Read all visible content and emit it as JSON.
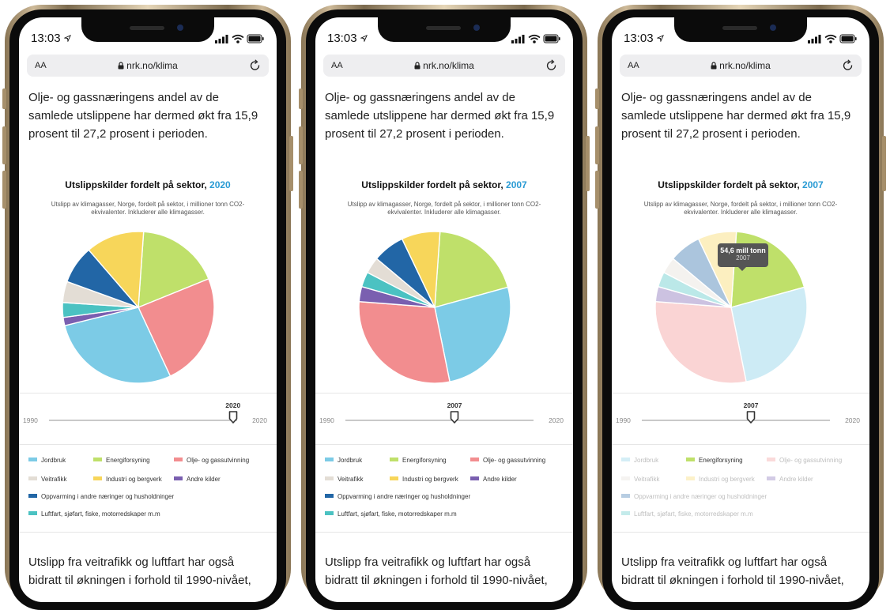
{
  "status": {
    "time": "13:03"
  },
  "browser": {
    "aa_label": "AA",
    "url": "nrk.no/klima"
  },
  "article": {
    "para1": "Olje- og gassnæringens andel av de samlede utslippene har dermed økt fra 15,9 prosent til 27,2 prosent i perioden.",
    "para2": "Utslipp fra veitrafikk og luftfart har også bidratt til økningen i forhold til 1990-nivået,"
  },
  "chart": {
    "title": "Utslippskilder fordelt på sektor,",
    "subtitle": "Utslipp av klimagasser, Norge, fordelt på sektor, i millioner tonn CO2-ekvivalenter. Inkluderer alle klimagasser.",
    "slider_min": "1990",
    "slider_max": "2020"
  },
  "legend": [
    {
      "label": "Jordbruk",
      "color": "#7ccbe6"
    },
    {
      "label": "Energiforsyning",
      "color": "#bfe06a"
    },
    {
      "label": "Olje- og gassutvinning",
      "color": "#f28d8f"
    },
    {
      "label": "Veitrafikk",
      "color": "#e3ddd5"
    },
    {
      "label": "Industri og bergverk",
      "color": "#f7d65a"
    },
    {
      "label": "Andre kilder",
      "color": "#7a5fb0"
    },
    {
      "label": "Oppvarming i andre næringer og husholdninger",
      "color": "#2266a6"
    },
    {
      "label": "Luftfart, sjøfart, fiske, motorredskaper m.m",
      "color": "#4bc2c2"
    }
  ],
  "tooltip": {
    "value": "54,6 mill tonn",
    "year": "2007"
  },
  "phones": [
    {
      "year": "2020",
      "slider_position": 0.978
    },
    {
      "year": "2007",
      "slider_position": 0.58
    },
    {
      "year": "2007",
      "slider_position": 0.58,
      "highlighted": "Energiforsyning"
    }
  ],
  "chart_data": [
    {
      "type": "pie",
      "title": "Utslippskilder fordelt på sektor, 2020",
      "labels": [
        "Energiforsyning",
        "Olje- og gassutvinning",
        "Jordbruk",
        "Andre kilder",
        "Luftfart, sjøfart, fiske, motorredskaper m.m",
        "Veitrafikk",
        "Oppvarming i andre næringer og husholdninger",
        "Industri og bergverk"
      ],
      "values": [
        18.1,
        24.7,
        28.6,
        1.8,
        3.2,
        4.6,
        8.3,
        12.7
      ]
    },
    {
      "type": "pie",
      "title": "Utslippskilder fordelt på sektor, 2007",
      "labels": [
        "Energiforsyning",
        "Jordbruk",
        "Olje- og gassutvinning",
        "Andre kilder",
        "Luftfart, sjøfart, fiske, motorredskaper m.m",
        "Veitrafikk",
        "Oppvarming i andre næringer og husholdninger",
        "Industri og bergverk"
      ],
      "values": [
        19.6,
        26.1,
        29.4,
        3.2,
        3.2,
        3.5,
        6.8,
        8.2
      ]
    },
    {
      "type": "pie",
      "title": "Utslippskilder fordelt på sektor, 2007",
      "labels": [
        "Energiforsyning",
        "Jordbruk",
        "Olje- og gassutvinning",
        "Andre kilder",
        "Luftfart, sjøfart, fiske, motorredskaper m.m",
        "Veitrafikk",
        "Oppvarming i andre næringer og husholdninger",
        "Industri og bergverk"
      ],
      "values": [
        19.6,
        26.1,
        29.4,
        3.2,
        3.2,
        3.5,
        6.8,
        8.2
      ]
    }
  ]
}
